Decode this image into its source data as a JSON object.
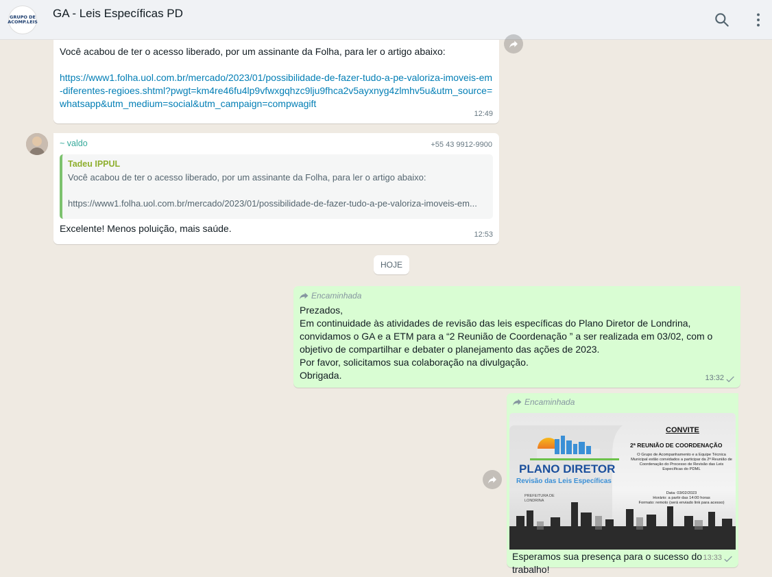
{
  "header": {
    "group_avatar_line1": "GRUPO DE",
    "group_avatar_line2": "ACOMP.LEIS",
    "title": "GA - Leis Específicas PD"
  },
  "messages": {
    "m1": {
      "text": "Você acabou de ter o acesso liberado, por um assinante da Folha, para ler o artigo abaixo:",
      "link": "https://www1.folha.uol.com.br/mercado/2023/01/possibilidade-de-fazer-tudo-a-pe-valoriza-imoveis-em-diferentes-regioes.shtml?pwgt=km4re46fu4lp9vfwxgqhzc9lju9fhca2v5ayxnyg4zlmhv5u&utm_source=whatsapp&utm_medium=social&utm_campaign=compwagift",
      "time": "12:49"
    },
    "m2": {
      "sender": "~ valdo",
      "phone": "+55 43 9912-9900",
      "quote_author": "Tadeu IPPUL",
      "quote_text": "Você acabou de ter o acesso liberado, por um assinante da Folha, para ler o artigo abaixo:",
      "quote_link": "https://www1.folha.uol.com.br/mercado/2023/01/possibilidade-de-fazer-tudo-a-pe-valoriza-imoveis-em...",
      "text": "Excelente! Menos poluição, mais saúde.",
      "time": "12:53"
    },
    "date_divider": "HOJE",
    "m3": {
      "forwarded_label": "Encaminhada",
      "text": "Prezados,\nEm continuidade às atividades de revisão das leis específicas do Plano Diretor de Londrina,\nconvidamos o GA e a ETM para a “2 Reunião de Coordenação ” a ser realizada em 03/02, com o\nobjetivo de compartilhar e debater o planejamento das ações de 2023.\nPor favor, solicitamos sua colaboração na divulgação.\nObrigada.",
      "time": "13:32"
    },
    "m4": {
      "forwarded_label": "Encaminhada",
      "image": {
        "convite": "CONVITE",
        "reuniao": "2ª REUNIÃO DE COORDENAÇÃO",
        "body": "O Grupo de Acompanhamento e a Equipe Técnica Municipal estão convidados a participar da 2ª Reunião de Coordenação do Processo de Revisão das Leis Específicas do PDML",
        "data": "Data: 03/02/2023",
        "horario": "Horário: a partir das 14:00 horas",
        "formato": "Formato: remoto (será enviado link para acesso)",
        "logo_title": "PLANO DIRETOR",
        "logo_subtitle": "Revisão das Leis Específicas",
        "prefeitura": "PREFEITURA DE LONDRINA"
      },
      "caption": "Esperamos sua presença para o sucesso do trabalho!",
      "time": "13:33"
    }
  }
}
